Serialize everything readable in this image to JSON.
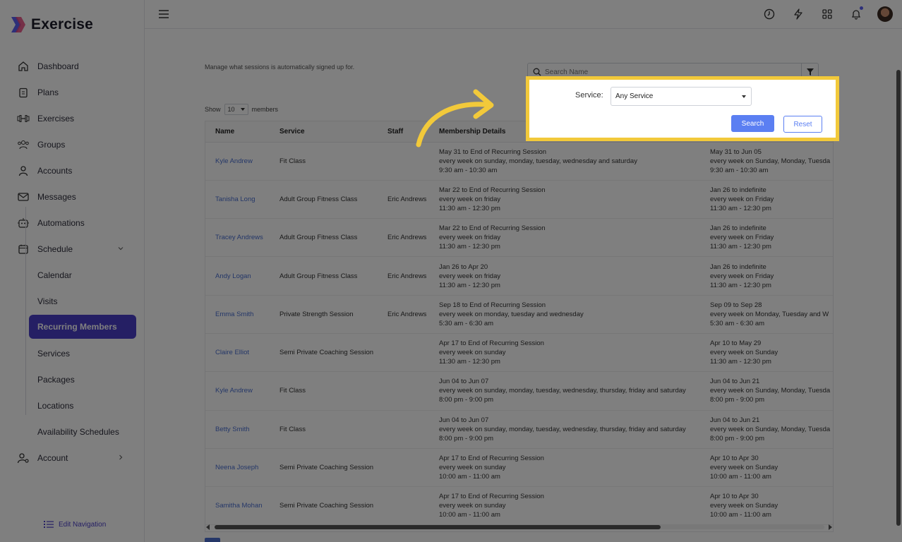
{
  "app": {
    "name": "Exercise"
  },
  "sidebar": {
    "items": [
      {
        "label": "Dashboard",
        "icon": "home-icon"
      },
      {
        "label": "Plans",
        "icon": "clipboard-icon"
      },
      {
        "label": "Exercises",
        "icon": "dumbbell-icon"
      },
      {
        "label": "Groups",
        "icon": "group-icon"
      },
      {
        "label": "Accounts",
        "icon": "user-icon"
      },
      {
        "label": "Messages",
        "icon": "mail-icon"
      },
      {
        "label": "Automations",
        "icon": "robot-icon"
      },
      {
        "label": "Schedule",
        "icon": "calendar-icon"
      }
    ],
    "schedule_sub": [
      {
        "label": "Calendar"
      },
      {
        "label": "Visits"
      },
      {
        "label": "Recurring Members",
        "active": true
      },
      {
        "label": "Services"
      },
      {
        "label": "Packages"
      },
      {
        "label": "Locations"
      },
      {
        "label": "Availability Schedules"
      }
    ],
    "account": {
      "label": "Account",
      "icon": "user-settings-icon"
    },
    "edit_navigation": "Edit Navigation"
  },
  "topbar": {
    "icons": [
      "clock-icon",
      "lightning-icon",
      "grid-icon",
      "bell-icon",
      "avatar"
    ]
  },
  "page": {
    "description": "Manage what sessions is automatically signed up for.",
    "search": {
      "placeholder": "Search Name",
      "value": ""
    },
    "show": {
      "prefix": "Show",
      "value": "10",
      "suffix": "members"
    }
  },
  "filter_popup": {
    "service_label": "Service:",
    "service_value": "Any Service",
    "search_button": "Search",
    "reset_button": "Reset",
    "highlight_color": "#f2c93a"
  },
  "table": {
    "columns": [
      "Name",
      "Service",
      "Staff",
      "Membership Details",
      ""
    ],
    "rows": [
      {
        "name": "Kyle Andrew",
        "service": "Fit Class",
        "staff": "",
        "details": "May 31 to End of Recurring Session\nevery week on sunday, monday, tuesday, wednesday and saturday\n9:30 am - 10:30 am",
        "current": "May 31 to Jun 05\nevery week on Sunday, Monday, Tuesda\n9:30 am - 10:30 am"
      },
      {
        "name": "Tanisha Long",
        "service": "Adult Group Fitness Class",
        "staff": "Eric Andrews",
        "details": "Mar 22 to End of Recurring Session\nevery week on friday\n11:30 am - 12:30 pm",
        "current": "Jan 26 to indefinite\nevery week on Friday\n11:30 am - 12:30 pm"
      },
      {
        "name": "Tracey Andrews",
        "service": "Adult Group Fitness Class",
        "staff": "Eric Andrews",
        "details": "Mar 22 to End of Recurring Session\nevery week on friday\n11:30 am - 12:30 pm",
        "current": "Jan 26 to indefinite\nevery week on Friday\n11:30 am - 12:30 pm"
      },
      {
        "name": "Andy Logan",
        "service": "Adult Group Fitness Class",
        "staff": "Eric Andrews",
        "details": "Jan 26 to Apr 20\nevery week on friday\n11:30 am - 12:30 pm",
        "current": "Jan 26 to indefinite\nevery week on Friday\n11:30 am - 12:30 pm"
      },
      {
        "name": "Emma Smith",
        "service": "Private Strength Session",
        "staff": "Eric Andrews",
        "details": "Sep 18 to End of Recurring Session\nevery week on monday, tuesday and wednesday\n5:30 am - 6:30 am",
        "current": "Sep 09 to Sep 28\nevery week on Monday, Tuesday and W\n5:30 am - 6:30 am"
      },
      {
        "name": "Claire Elliot",
        "service": "Semi Private Coaching Session",
        "staff": "",
        "details": "Apr 17 to End of Recurring Session\nevery week on sunday\n11:30 am - 12:30 pm",
        "current": "Apr 10 to May 29\nevery week on Sunday\n11:30 am - 12:30 pm"
      },
      {
        "name": "Kyle Andrew",
        "service": "Fit Class",
        "staff": "",
        "details": "Jun 04 to Jun 07\nevery week on sunday, monday, tuesday, wednesday, thursday, friday and saturday\n8:00 pm - 9:00 pm",
        "current": "Jun 04 to Jun 21\nevery week on Sunday, Monday, Tuesda\n8:00 pm - 9:00 pm"
      },
      {
        "name": "Betty Smith",
        "service": "Fit Class",
        "staff": "",
        "details": "Jun 04 to Jun 07\nevery week on sunday, monday, tuesday, wednesday, thursday, friday and saturday\n8:00 pm - 9:00 pm",
        "current": "Jun 04 to Jun 21\nevery week on Sunday, Monday, Tuesda\n8:00 pm - 9:00 pm"
      },
      {
        "name": "Neena Joseph",
        "service": "Semi Private Coaching Session",
        "staff": "",
        "details": "Apr 17 to End of Recurring Session\nevery week on sunday\n10:00 am - 11:00 am",
        "current": "Apr 10 to Apr 30\nevery week on Sunday\n10:00 am - 11:00 am"
      },
      {
        "name": "Samitha Mohan",
        "service": "Semi Private Coaching Session",
        "staff": "",
        "details": "Apr 17 to End of Recurring Session\nevery week on sunday\n10:00 am - 11:00 am",
        "current": "Apr 10 to Apr 30\nevery week on Sunday\n10:00 am - 11:00 am"
      }
    ]
  }
}
